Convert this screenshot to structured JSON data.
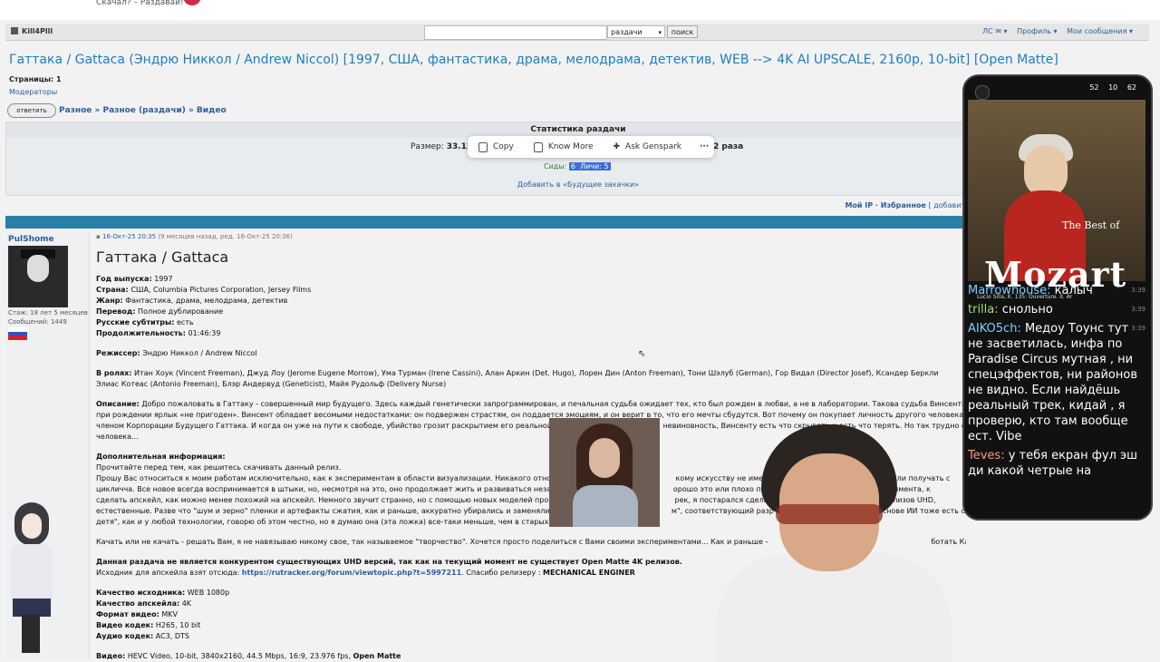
{
  "header": {
    "tagline": "Скачал? – Раздавай!"
  },
  "topbar": {
    "username": "Kill4Plll",
    "search_placeholder": "",
    "search_scope": "раздачи",
    "search_button": "поиск",
    "links": [
      "ЛС ✉ ▾",
      "Профиль ▾",
      "Мои сообщения ▾"
    ]
  },
  "topic": {
    "title": "Гаттака / Gattaca (Эндрю Никкол / Andrew Niccol) [1997, США, фантастика, драма, мелодрама, детектив, WEB --> 4K AI UPSCALE, 2160p, 10-bit] [Open Matte]",
    "pages_label": "Страницы:",
    "pages_value": "1",
    "moderators": "Модераторы",
    "reply_button": "ответить",
    "breadcrumb": "Разное » Разное (раздачи) » Видео"
  },
  "stats": {
    "header": "Статистика раздачи",
    "size_label": "Размер:",
    "size_value": "33.12",
    "downloads_tail": "2 раза",
    "seeds_label": "Сиды:",
    "seeds_value": "6",
    "leeches_label": "Личи:",
    "leeches_value": "5",
    "future_link": "Добавить в «Будущие закачки»"
  },
  "popup": {
    "copy": "Copy",
    "know_more": "Know More",
    "ask": "Ask Genspark",
    "more": "···"
  },
  "toolbar2": {
    "myip": "Мой IP · Избранное",
    "add": "[ добавить ] · М"
  },
  "post": {
    "author": "PulShome",
    "experience_label": "Стаж:",
    "experience_value": "18 лет 5 месяцев",
    "messages_label": "Сообщений:",
    "messages_value": "1449",
    "date": "16-Окт-25 20:35",
    "edit_note": "(9 месяцев назад, ред. 16-Окт-25 20:36)",
    "heading": "Гаттака / Gattaca",
    "year_label": "Год выпуска:",
    "year": "1997",
    "country_label": "Страна:",
    "country": "США, Columbia Pictures Corporation, Jersey Films",
    "genre_label": "Жанр:",
    "genre": "Фантастика, драма, мелодрама, детектив",
    "translation_label": "Перевод:",
    "translation": "Полное дублирование",
    "subs_label": "Русские субтитры:",
    "subs": "есть",
    "duration_label": "Продолжительность:",
    "duration": "01:46:39",
    "director_label": "Режиссер:",
    "director": "Эндрю Никкол / Andrew Niccol",
    "cast_label": "В ролях:",
    "cast": "Итан Хоук (Vincent Freeman), Джуд Лоу (Jerome Eugene Morrow), Ума Турман (Irene Cassini), Алан Аркин (Det. Hugo), Лорен Дин (Anton Freeman), Тони Шэлуб (German), Гор Видал (Director Josef), Ксандер Беркли",
    "cast2": "Элиас Котеас (Antonio Freeman), Блэр Андервуд (Geneticist), Майя Рудольф (Delivery Nurse)",
    "desc_label": "Описание:",
    "desc1": "Добро пожаловать в Гаттаку - совершенный мир будущего. Здесь каждый генетически запрограммирован, и печальная судьба ожидает тех, кто был рожден в любви, а не в лаборатории. Такова судьба Винсента",
    "desc2": "при рождении ярлык «не пригоден». Винсент обладает весомыми недостатками: он подвержен страстям, он поддается эмоциям, и он верит в то, что его мечты сбудутся. Вот почему он покупает личность другого человека, к",
    "desc3": "членом Корпорации Будущего Гаттака. И когда он уже на пути к свободе, убийство грозит раскрытием его реальной",
    "desc3b": "невиновность, Винсенту есть что скрывать и есть что терять. Но так трудно о",
    "desc4": "человека...",
    "extra_label": "Дополнительная информация:",
    "extra1": "Прочитайте перед тем, как решитесь скачивать данный релиз.",
    "extra2": "Прошу Вас относиться к моим работам исключительно, как к экспериментам в области визуализации. Никакого отнош",
    "extra2b": "кому искусству не имеют.",
    "extra2c": "инимать или получать с",
    "extra3": "цикличча. Все новое всегда воспринимается в штыки, но, несмотря на это, оно продолжает жить и развиваться незав",
    "extra3b": "орошо это или плохо покаж",
    "extra3c": "этого эксперимента, к",
    "extra4": "сделать апскейл, как можно менее похожий на апскейл. Немного звучит странно, но с помощью новых моделей прогр",
    "extra4b": "рек, я постарался сделать",
    "extra4c": "была как у релизов UHD,",
    "extra5": "естественные. Разве что \"шум и зерно\" пленки и артефакты сжатия, как и раньше, аккуратно убирались и заменялис",
    "extra5b": "м\", соответствующий разр",
    "extra5c": "овых моделей на основе ИИ тоже есть с",
    "extra6": "детя\", как и у любой технологии, говорю об этом честно, но я думаю она (эта ложка) все-таки меньше, чем в старых",
    "extra7": "Качать или не качать - решать Вам, я не навязываю никому свое, так называемое \"творчество\". Хочется просто поделиться с Вами своими экспериментами... Как и раньше -",
    "extra7b": "ботать Как Вам угодно. Всем удачи и здоровья.",
    "notice": "Данная раздача не является конкурентом существующих UHD версий, так как на текущий момент не существует Open Matte 4K релизов.",
    "source_label": "Исходник для апскейла взят отсюда:",
    "source_link": "https://rutracker.org/forum/viewtopic.php?t=5997211",
    "source_thanks": ". Спасибо релизеру :",
    "source_releaser": "MECHANICAL ENGINER",
    "quality_src_label": "Качество исходника:",
    "quality_src": "WEB 1080p",
    "quality_up_label": "Качество апскейла:",
    "quality_up": "4K",
    "format_label": "Формат видео:",
    "format": "MKV",
    "vcodec_label": "Видео кодек:",
    "vcodec": "H265, 10 bit",
    "acodec_label": "Аудио кодек:",
    "acodec": "AC3, DTS",
    "video_label": "Видео:",
    "video": "HEVC Video, 10-bit, 3840x2160, 44.5 Mbps, 16:9, 23.976 fps,",
    "video_tail": "Open Matte"
  },
  "phone": {
    "status": [
      "52",
      "10",
      "62"
    ],
    "best_of": "The Best of",
    "album": "Mozart",
    "track": "Lucio Silla, K. 135: Ouverture. II. Ar",
    "chat": [
      {
        "user": "Marrowhouse:",
        "text": "калыч",
        "time": "3:39"
      },
      {
        "user": "trilla:",
        "text": "снольно",
        "time": "3:39"
      },
      {
        "user": "AIKO5ch:",
        "text": "Медоу Тоунс тут не засветилась, инфа по Paradise Circus мутная , ни спецэффектов, ни районов не видно. Если найдёшь реальный трек, кидай , я проверю, кто там вообще ест. Vibe",
        "time": "3:39"
      },
      {
        "user": "Teves:",
        "text": "у тебя екран фул эш ди какой четрые на",
        "time": ""
      }
    ]
  }
}
